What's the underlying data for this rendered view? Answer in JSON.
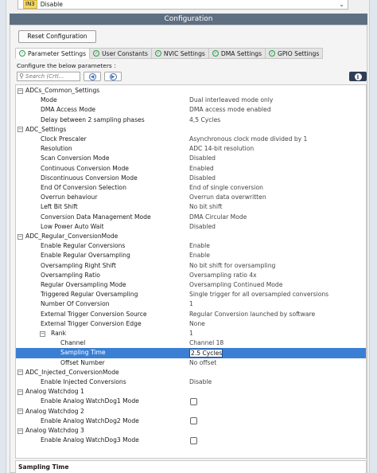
{
  "top_dropdown": {
    "tag": "IN3",
    "value": "Disable"
  },
  "header": {
    "title": "Configuration"
  },
  "reset_button": "Reset Configuration",
  "tabs": [
    {
      "label": "Parameter Settings",
      "active": true
    },
    {
      "label": "User Constants",
      "active": false
    },
    {
      "label": "NVIC Settings",
      "active": false
    },
    {
      "label": "DMA Settings",
      "active": false
    },
    {
      "label": "GPIO Settings",
      "active": false
    }
  ],
  "configure_label": "Configure the below parameters :",
  "search": {
    "placeholder": "Search (Crtl..."
  },
  "tree": [
    {
      "level": 0,
      "expander": "−",
      "name": "ADCs_Common_Settings"
    },
    {
      "level": 1,
      "name": "Mode",
      "value": "Dual interleaved mode only"
    },
    {
      "level": 1,
      "name": "DMA Access Mode",
      "value": "DMA access mode enabled"
    },
    {
      "level": 1,
      "name": "Delay between 2 sampling phases",
      "value": "4,5 Cycles"
    },
    {
      "level": 0,
      "expander": "−",
      "name": "ADC_Settings"
    },
    {
      "level": 1,
      "name": "Clock Prescaler",
      "value": "Asynchronous clock mode divided by 1"
    },
    {
      "level": 1,
      "name": "Resolution",
      "value": "ADC 14-bit resolution"
    },
    {
      "level": 1,
      "name": "Scan Conversion Mode",
      "value": "Disabled"
    },
    {
      "level": 1,
      "name": "Continuous Conversion Mode",
      "value": "Enabled"
    },
    {
      "level": 1,
      "name": "Discontinuous Conversion Mode",
      "value": "Disabled"
    },
    {
      "level": 1,
      "name": "End Of Conversion Selection",
      "value": "End of single conversion"
    },
    {
      "level": 1,
      "name": "Overrun behaviour",
      "value": "Overrun data overwritten"
    },
    {
      "level": 1,
      "name": "Left Bit Shift",
      "value": "No bit shift"
    },
    {
      "level": 1,
      "name": "Conversion Data Management Mode",
      "value": "DMA Circular Mode"
    },
    {
      "level": 1,
      "name": "Low Power Auto Wait",
      "value": "Disabled"
    },
    {
      "level": 0,
      "expander": "−",
      "name": "ADC_Regular_ConversionMode"
    },
    {
      "level": 1,
      "name": "Enable Regular Conversions",
      "value": "Enable"
    },
    {
      "level": 1,
      "name": "Enable Regular Oversampling",
      "value": "Enable"
    },
    {
      "level": 1,
      "name": "Oversampling Right Shift",
      "value": "No bit shift for oversampling"
    },
    {
      "level": 1,
      "name": "Oversampling Ratio",
      "value": "Oversampling ratio 4x"
    },
    {
      "level": 1,
      "name": "Regular Oversampling Mode",
      "value": "Oversampling Continued Mode"
    },
    {
      "level": 1,
      "name": "Triggered Regular Oversampling",
      "value": "Single trigger for all oversampled conversions"
    },
    {
      "level": 1,
      "name": "Number Of Conversion",
      "value": "1"
    },
    {
      "level": 1,
      "name": "External Trigger Conversion Source",
      "value": "Regular Conversion launched by software"
    },
    {
      "level": 1,
      "name": "External Trigger Conversion Edge",
      "value": "None"
    },
    {
      "level": 1,
      "expander": "−",
      "name": "Rank",
      "value": "1",
      "name_indent": 2
    },
    {
      "level": 3,
      "name": "Channel",
      "value": "Channel 18"
    },
    {
      "level": 3,
      "name": "Sampling Time",
      "value": "2.5 Cycles",
      "selected": true
    },
    {
      "level": 3,
      "name": "Offset Number",
      "value": "No offset"
    },
    {
      "level": 0,
      "expander": "−",
      "name": "ADC_Injected_ConversionMode"
    },
    {
      "level": 1,
      "name": "Enable Injected Conversions",
      "value": "Disable"
    },
    {
      "level": 0,
      "expander": "−",
      "name": "Analog Watchdog 1"
    },
    {
      "level": 1,
      "name": "Enable Analog WatchDog1 Mode",
      "checkbox": true
    },
    {
      "level": 0,
      "expander": "−",
      "name": "Analog Watchdog 2"
    },
    {
      "level": 1,
      "name": "Enable Analog WatchDog2 Mode",
      "checkbox": true
    },
    {
      "level": 0,
      "expander": "−",
      "name": "Analog Watchdog 3"
    },
    {
      "level": 1,
      "name": "Enable Analog WatchDog3 Mode",
      "checkbox": true
    }
  ],
  "description": {
    "title": "Sampling Time"
  }
}
